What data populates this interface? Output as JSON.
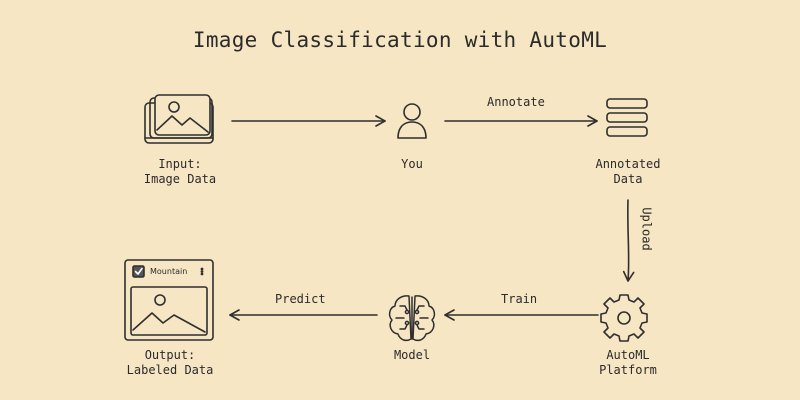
{
  "title": "Image Classification with AutoML",
  "nodes": {
    "input": {
      "line1": "Input:",
      "line2": "Image Data"
    },
    "you": {
      "line1": "You"
    },
    "annotated": {
      "line1": "Annotated",
      "line2": "Data"
    },
    "automl": {
      "line1": "AutoML",
      "line2": "Platform"
    },
    "model": {
      "line1": "Model"
    },
    "output": {
      "line1": "Output:",
      "line2": "Labeled Data",
      "tag": "Mountain"
    }
  },
  "edges": {
    "annotate": "Annotate",
    "upload": "Upload",
    "train": "Train",
    "predict": "Predict"
  },
  "colors": {
    "background": "#f6e6c4",
    "stroke": "#2f2f2f"
  }
}
